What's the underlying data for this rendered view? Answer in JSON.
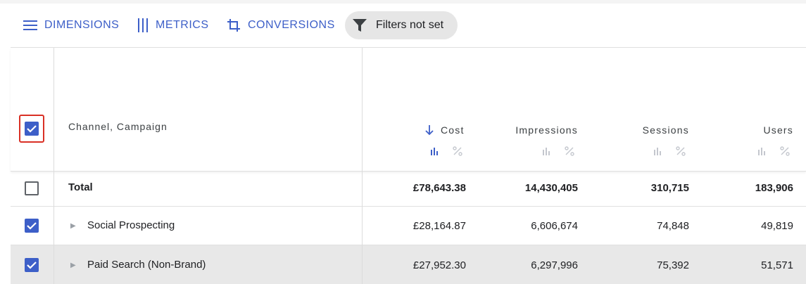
{
  "toolbar": {
    "dimensions_label": "DIMENSIONS",
    "metrics_label": "METRICS",
    "conversions_label": "CONVERSIONS",
    "filter_label": "Filters not set"
  },
  "table": {
    "dimension_header": "Channel, Campaign",
    "columns": [
      {
        "label": "Cost",
        "sorted": "descending"
      },
      {
        "label": "Impressions"
      },
      {
        "label": "Sessions"
      },
      {
        "label": "Users"
      }
    ],
    "total": {
      "label": "Total",
      "checked": false,
      "values": [
        "£78,643.38",
        "14,430,405",
        "310,715",
        "183,906"
      ]
    },
    "rows": [
      {
        "label": "Social Prospecting",
        "checked": true,
        "values": [
          "£28,164.87",
          "6,606,674",
          "74,848",
          "49,819"
        ]
      },
      {
        "label": "Paid Search (Non-Brand)",
        "checked": true,
        "values": [
          "£27,952.30",
          "6,297,996",
          "75,392",
          "51,571"
        ]
      }
    ]
  },
  "colors": {
    "accent": "#3d5fc8",
    "focus_outline": "#d93025",
    "chip_bg": "#e6e6e6",
    "row_shaded": "#e8e8e8"
  },
  "icons": [
    "menu-lines-icon",
    "vertical-bars-icon",
    "crop-icon",
    "filter-funnel-icon",
    "arrow-down-icon",
    "bar-chart-icon",
    "percent-icon",
    "caret-right-icon",
    "checkmark-icon"
  ]
}
